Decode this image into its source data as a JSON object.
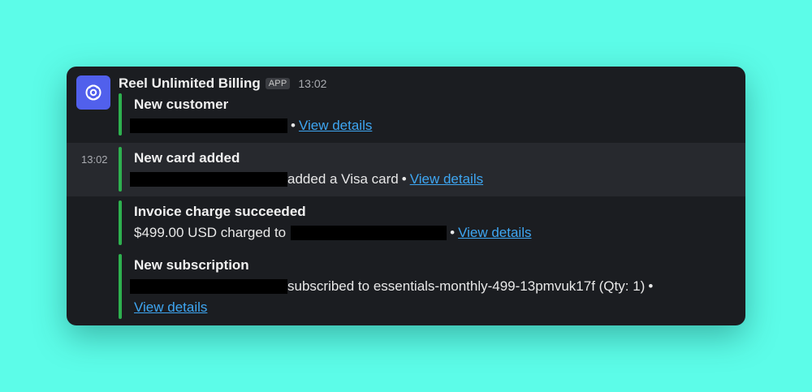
{
  "sender": {
    "name": "Reel Unlimited Billing",
    "badge": "APP",
    "time": "13:02"
  },
  "messages": [
    {
      "title": "New customer",
      "text_after": "",
      "bullet": "•",
      "link": "View details"
    },
    {
      "side_time": "13:02",
      "title": "New card added",
      "text_after": "added a Visa card",
      "bullet": "•",
      "link": "View details"
    },
    {
      "title": "Invoice charge succeeded",
      "text_before": "$499.00 USD charged to",
      "bullet": "•",
      "link": "View details"
    },
    {
      "title": "New subscription",
      "text_after": "subscribed to essentials-monthly-499-13pmvuk17f (Qty: 1)",
      "bullet": "•",
      "link": "View details"
    }
  ],
  "colors": {
    "background": "#5cfce8",
    "card": "#1b1d21",
    "accent_bar": "#2eb14f",
    "link": "#3ea6f2",
    "avatar": "#5160ec"
  }
}
